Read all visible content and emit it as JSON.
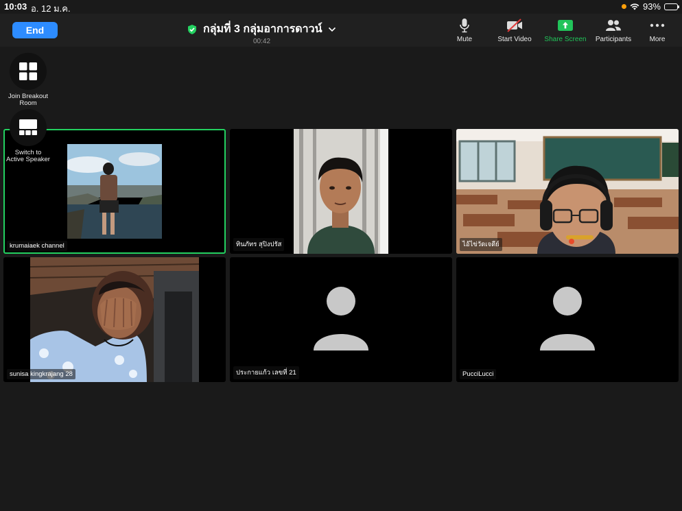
{
  "status": {
    "time": "10:03",
    "date": "อ. 12 ม.ค.",
    "battery": "93%"
  },
  "toolbar": {
    "end_label": "End",
    "meeting_title": "กลุ่มที่ 3 กลุ่มอาการดาวน์",
    "timer": "00:42",
    "mute_label": "Mute",
    "start_video_label": "Start Video",
    "share_screen_label": "Share Screen",
    "participants_label": "Participants",
    "more_label": "More"
  },
  "side": {
    "breakout_label": "Join Breakout Room",
    "switch_label": "Switch to Active Speaker"
  },
  "participants": [
    {
      "name": "krumaiaek channel",
      "video": true,
      "active": true
    },
    {
      "name": "ทินภัทร สุปิงปรัส",
      "video": true
    },
    {
      "name": "ไอ้ไข่วัดเจดีย์",
      "video": true
    },
    {
      "name": "sunisa kingkrajang 28",
      "video": true
    },
    {
      "name": "ประกายแก้ว เลขที่ 21",
      "video": false
    },
    {
      "name": "PucciLucci",
      "video": false
    }
  ],
  "colors": {
    "accent": "#2d8cff",
    "active_border": "#23d160",
    "share_green": "#21c45a"
  }
}
